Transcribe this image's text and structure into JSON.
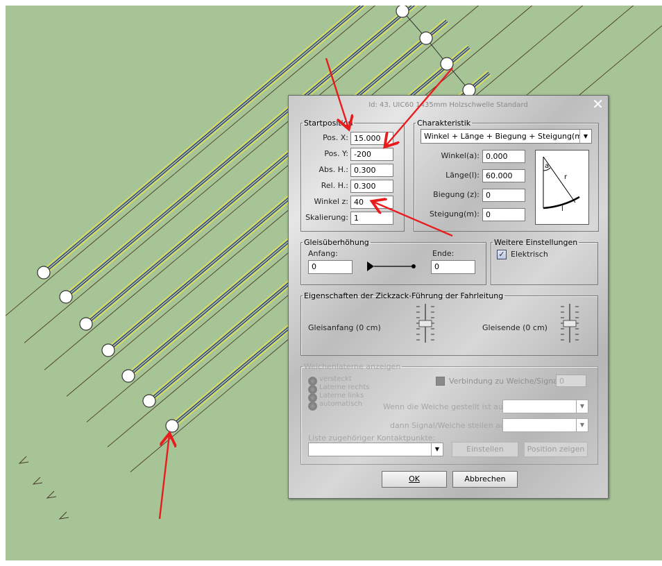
{
  "dialog": {
    "title": "Id: 43, UIC60 1435mm Holzschwelle Standard",
    "close_glyph": "✕",
    "startposition": {
      "legend": "Startposition",
      "fields": [
        {
          "label": "Pos. X:",
          "value": "15.000"
        },
        {
          "label": "Pos. Y:",
          "value": "-200"
        },
        {
          "label": "Abs. H.:",
          "value": "0.300"
        },
        {
          "label": "Rel. H.:",
          "value": "0.300"
        },
        {
          "label": "Winkel z:",
          "value": "40"
        },
        {
          "label": "Skalierung:",
          "value": "1"
        }
      ]
    },
    "charakteristik": {
      "legend": "Charakteristik",
      "mode_value": "Winkel + Länge + Biegung + Steigung(m)",
      "fields": [
        {
          "label": "Winkel(a):",
          "value": "0.000"
        },
        {
          "label": "Länge(l):",
          "value": "60.000"
        },
        {
          "label": "Biegung (z):",
          "value": "0"
        },
        {
          "label": "Steigung(m):",
          "value": "0"
        }
      ],
      "diagram_labels": {
        "a": "a",
        "r": "r",
        "l": "l"
      }
    },
    "gleisueberhoehung": {
      "legend": "Gleisüberhöhung",
      "start_label": "Anfang:",
      "start_value": "0",
      "end_label": "Ende:",
      "end_value": "0"
    },
    "weitere": {
      "legend": "Weitere Einstellungen",
      "elektrisch_label": "Elektrisch",
      "elektrisch_checked": true
    },
    "zickzack": {
      "legend": "Eigenschaften der Zickzack-Führung der Fahrleitung",
      "start_label": "Gleisanfang (0 cm)",
      "end_label": "Gleisende (0 cm)",
      "start_offset_cm": 0,
      "end_offset_cm": 0
    },
    "weichenlaterne": {
      "legend": "Weichenlaterne anzeigen",
      "radios": [
        "versteckt",
        "Laterne rechts",
        "Laterne links",
        "automatisch"
      ],
      "verbindung_label": "Verbindung zu Weiche/Signal",
      "verbindung_value": "0",
      "wenn_label": "Wenn die Weiche gestellt ist auf:",
      "dann_label": "dann Signal/Weiche stellen auf:",
      "liste_label": "Liste zugehöriger Kontaktpunkte:",
      "einstellen_label": "Einstellen",
      "position_label": "Position zeigen"
    },
    "ok_label": "OK",
    "cancel_label": "Abbrechen"
  },
  "colors": {
    "background": "#a6c496",
    "track_yellow": "#e8e24a",
    "track_blue": "#1a1a6e",
    "arrow_red": "#e81c1c"
  }
}
